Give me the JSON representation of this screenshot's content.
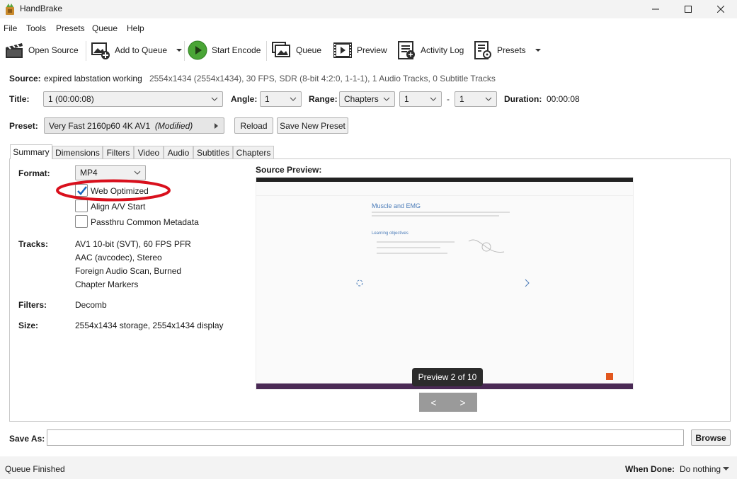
{
  "window": {
    "title": "HandBrake"
  },
  "menu": [
    "File",
    "Tools",
    "Presets",
    "Queue",
    "Help"
  ],
  "toolbar": {
    "open_source": "Open Source",
    "add_to_queue": "Add to Queue",
    "start_encode": "Start Encode",
    "queue": "Queue",
    "preview": "Preview",
    "activity_log": "Activity Log",
    "presets": "Presets"
  },
  "source": {
    "label": "Source:",
    "name": "expired labstation working",
    "info": "2554x1434 (2554x1434), 30 FPS, SDR (8-bit 4:2:0, 1-1-1), 1 Audio Tracks, 0 Subtitle Tracks"
  },
  "title_row": {
    "title_label": "Title:",
    "title_value": "1  (00:00:08)",
    "angle_label": "Angle:",
    "angle_value": "1",
    "range_label": "Range:",
    "range_type": "Chapters",
    "range_start": "1",
    "range_sep": "-",
    "range_end": "1",
    "duration_label": "Duration:",
    "duration_value": "00:00:08"
  },
  "preset_row": {
    "label": "Preset:",
    "name": "Very Fast 2160p60 4K AV1",
    "modified": "(Modified)",
    "reload": "Reload",
    "save_new": "Save New Preset"
  },
  "tabs": [
    "Summary",
    "Dimensions",
    "Filters",
    "Video",
    "Audio",
    "Subtitles",
    "Chapters"
  ],
  "summary": {
    "format_label": "Format:",
    "format_value": "MP4",
    "web_optimized": "Web Optimized",
    "web_optimized_checked": true,
    "align_av": "Align A/V Start",
    "align_av_checked": false,
    "passthru_meta": "Passthru Common Metadata",
    "passthru_meta_checked": false,
    "tracks_label": "Tracks:",
    "tracks": [
      "AV1 10-bit (SVT), 60 FPS PFR",
      "AAC (avcodec), Stereo",
      "Foreign Audio Scan, Burned",
      "Chapter Markers"
    ],
    "filters_label": "Filters:",
    "filters_value": "Decomb",
    "size_label": "Size:",
    "size_value": "2554x1434 storage, 2554x1434 display"
  },
  "preview": {
    "label": "Source Preview:",
    "badge": "Preview 2 of 10",
    "prev": "<",
    "next": ">",
    "thumb_heading": "Muscle and EMG",
    "thumb_subheading": "Learning objectives"
  },
  "save_as": {
    "label": "Save As:",
    "value": "",
    "browse": "Browse"
  },
  "status": {
    "text": "Queue Finished",
    "when_done_label": "When Done:",
    "when_done_value": "Do nothing"
  },
  "colors": {
    "highlight_ellipse": "#d9101d",
    "start_encode_green": "#4aa536",
    "checkmark_blue": "#1565c0"
  }
}
